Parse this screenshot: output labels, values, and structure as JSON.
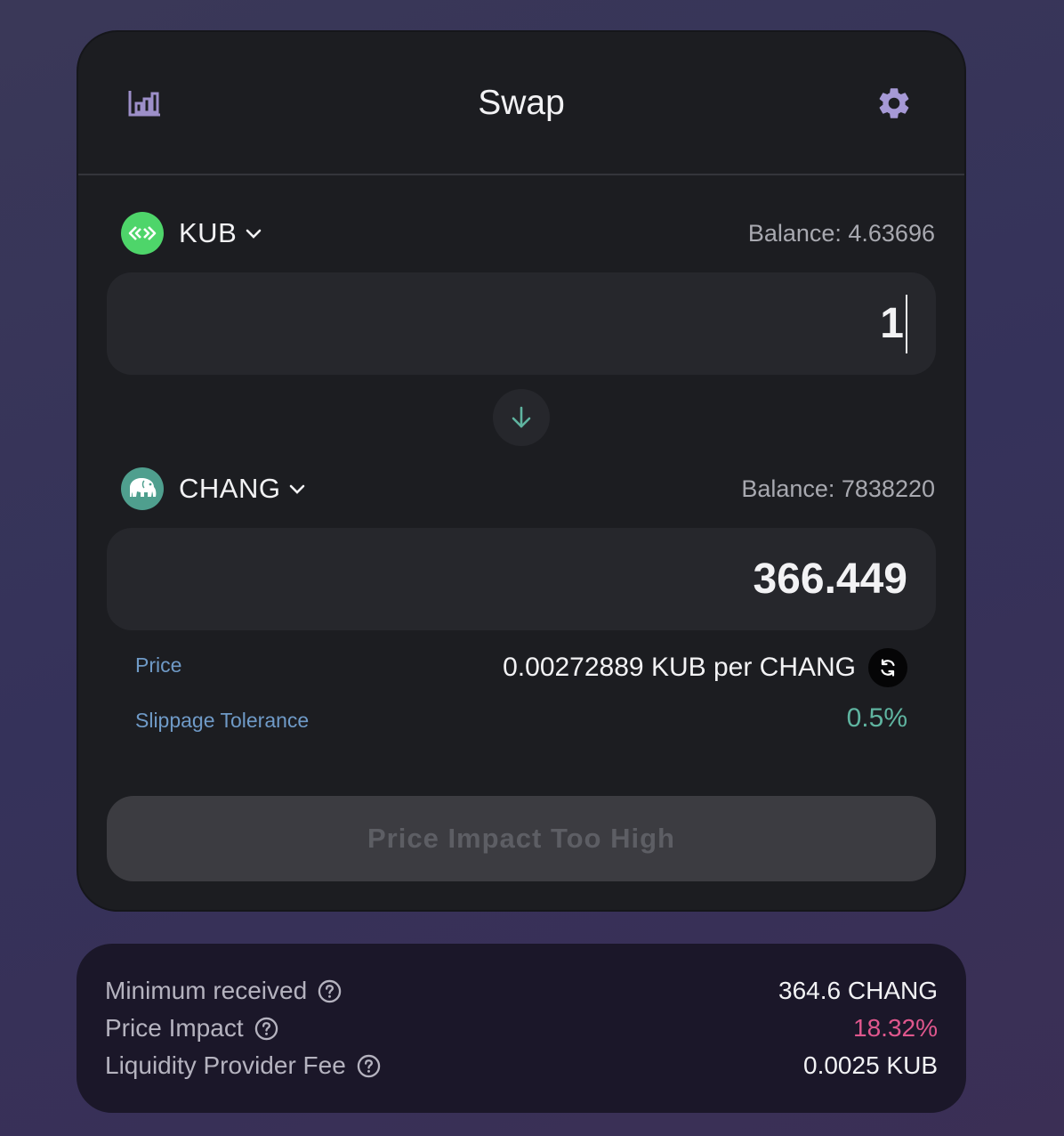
{
  "header": {
    "title": "Swap"
  },
  "from": {
    "token": "KUB",
    "balance": "Balance: 4.63696",
    "amount": "1"
  },
  "to": {
    "token": "CHANG",
    "balance": "Balance: 7838220",
    "amount": "366.449"
  },
  "info": {
    "price_label": "Price",
    "price_value": "0.00272889 KUB per CHANG",
    "slippage_label": "Slippage Tolerance",
    "slippage_value": "0.5%"
  },
  "action": {
    "label": "Price Impact Too High"
  },
  "details": {
    "min_received_label": "Minimum received",
    "min_received_value": "364.6 CHANG",
    "price_impact_label": "Price Impact",
    "price_impact_value": "18.32%",
    "lp_fee_label": "Liquidity Provider Fee",
    "lp_fee_value": "0.0025 KUB"
  },
  "colors": {
    "accent_teal": "#5fb4a0",
    "warning_pink": "#e0578d",
    "link_blue": "#6f9ac7",
    "kub_green": "#4ed56a"
  }
}
